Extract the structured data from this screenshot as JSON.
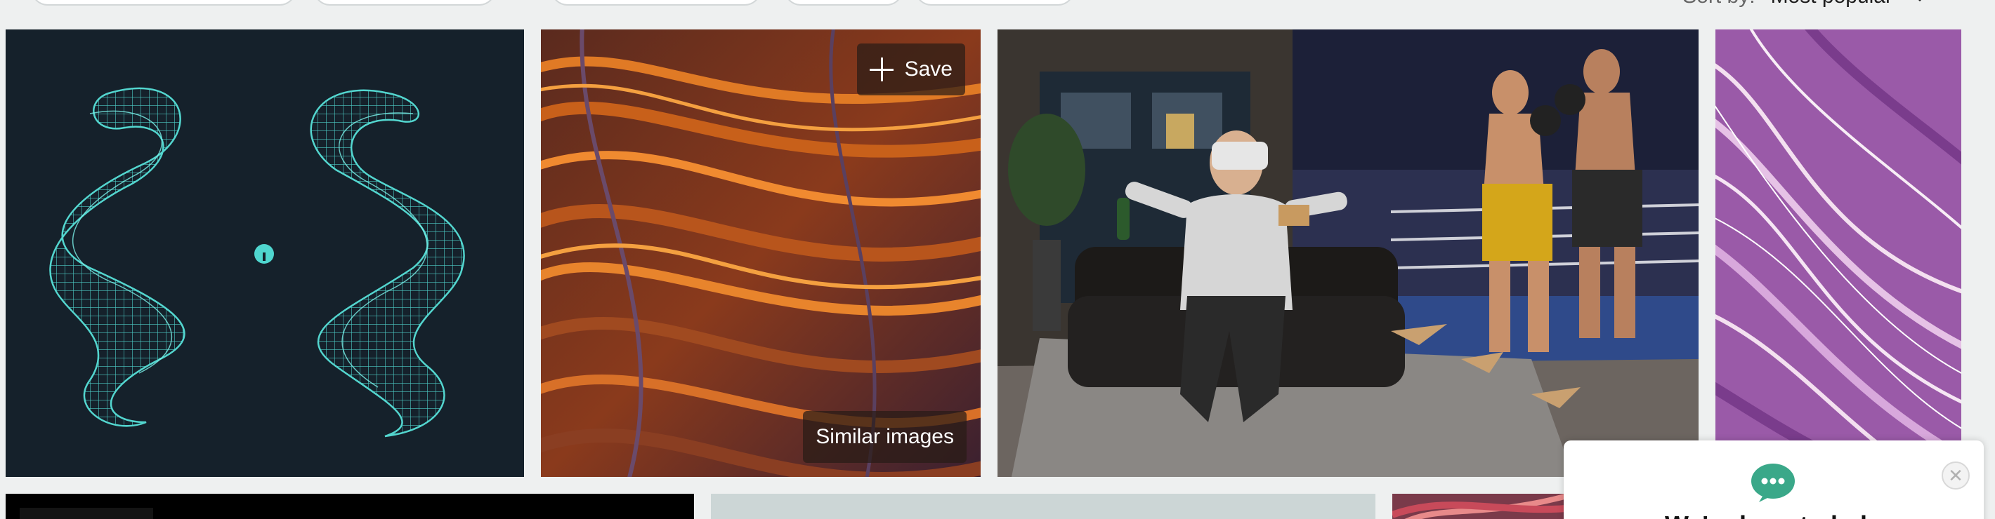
{
  "sort": {
    "label": "Sort by:",
    "value": "Most popular"
  },
  "tiles": {
    "hovered": {
      "save_label": "Save",
      "similar_label": "Similar images"
    }
  },
  "chat": {
    "title": "We're here to help"
  },
  "colors": {
    "overlay": "#281c16",
    "chat_accent": "#3aa889",
    "wireframe": "#4fd6cf",
    "wireframe_bg": "#15212b"
  },
  "icons": [
    "plus-icon",
    "chat-bubble-icon",
    "close-icon",
    "chevron-down-icon",
    "info-icon"
  ]
}
